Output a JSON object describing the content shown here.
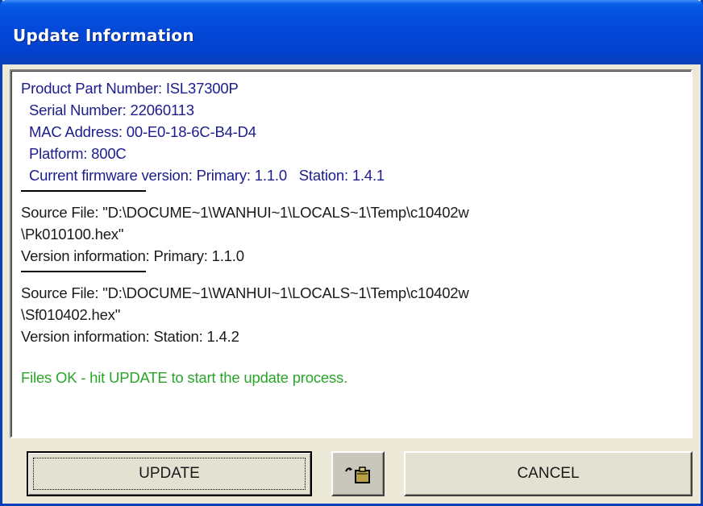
{
  "window": {
    "title": "Update Information"
  },
  "info": {
    "product_part_number": "Product Part Number: ISL37300P",
    "serial_number": "Serial Number: 22060113",
    "mac_address": "MAC Address: 00-E0-18-6C-B4-D4",
    "platform": "Platform: 800C",
    "current_firmware": "Current firmware version: Primary: 1.1.0   Station: 1.4.1",
    "file1": {
      "source_line1": "Source File: \"D:\\DOCUME~1\\WANHUI~1\\LOCALS~1\\Temp\\c10402w",
      "source_line2": "\\Pk010100.hex\"",
      "version": "Version information: Primary: 1.1.0"
    },
    "file2": {
      "source_line1": "Source File: \"D:\\DOCUME~1\\WANHUI~1\\LOCALS~1\\Temp\\c10402w",
      "source_line2": "\\Sf010402.hex\"",
      "version": "Version information: Station: 1.4.2"
    },
    "status_message": "Files OK - hit UPDATE to start the update process."
  },
  "buttons": {
    "update_label": "UPDATE",
    "icon_name": "clipboard-icon",
    "cancel_label": "CANCEL"
  },
  "colors": {
    "title_bar": "#0346d6",
    "info_text": "#1c1c8c",
    "status_text": "#2aa52a"
  }
}
